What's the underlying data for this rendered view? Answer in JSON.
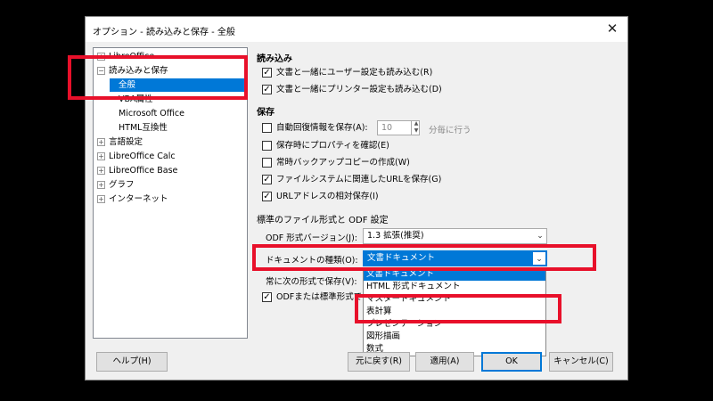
{
  "dialog": {
    "title": "オプション - 読み込みと保存 - 全般",
    "close_label": "✕"
  },
  "tree": {
    "items": [
      {
        "label": "LibreOffice",
        "expander": "⊞"
      },
      {
        "label": "読み込みと保存",
        "expander": "⊟"
      },
      {
        "label": "全般",
        "expander": ""
      },
      {
        "label": "VBA属性",
        "expander": ""
      },
      {
        "label": "Microsoft Office",
        "expander": ""
      },
      {
        "label": "HTML互換性",
        "expander": ""
      },
      {
        "label": "言語設定",
        "expander": "⊞"
      },
      {
        "label": "LibreOffice Calc",
        "expander": "⊞"
      },
      {
        "label": "LibreOffice Base",
        "expander": "⊞"
      },
      {
        "label": "グラフ",
        "expander": "⊞"
      },
      {
        "label": "インターネット",
        "expander": "⊞"
      }
    ]
  },
  "load": {
    "heading": "読み込み",
    "opt1": "文書と一緒にユーザー設定も読み込む(R)",
    "opt2": "文書と一緒にプリンター設定も読み込む(D)",
    "opt1_checked": "✓",
    "opt2_checked": "✓"
  },
  "save": {
    "heading": "保存",
    "autosave": "自動回復情報を保存(A):",
    "autosave_value": "10",
    "autosave_unit": "分毎に行う",
    "props": "保存時にプロパティを確認(E)",
    "backup": "常時バックアップコピーの作成(W)",
    "fs_url": "ファイルシステムに関連したURLを保存(G)",
    "net_url": "URLアドレスの相対保存(I)",
    "fs_checked": "✓",
    "net_checked": "✓"
  },
  "format": {
    "heading": "標準のファイル形式と ODF 設定",
    "odf_label": "ODF 形式バージョン(J):",
    "odf_value": "1.3 拡張(推奨)",
    "doctype_label": "ドキュメントの種類(O):",
    "doctype_value": "文書ドキュメント",
    "always_save": "常に次の形式で保存(V):",
    "warn": "ODFまたは標準形式で",
    "warn_checked": "✓"
  },
  "dropdown_options": [
    "文書ドキュメント",
    "HTML 形式ドキュメント",
    "マスタードキュメント",
    "表計算",
    "プレゼンテーション",
    "図形描画",
    "数式"
  ],
  "buttons": {
    "help": "ヘルプ(H)",
    "reset": "元に戻す(R)",
    "apply": "適用(A)",
    "ok": "OK",
    "cancel": "キャンセル(C)"
  },
  "colors": {
    "highlight": "#e8102a",
    "selection": "#0078d7"
  }
}
